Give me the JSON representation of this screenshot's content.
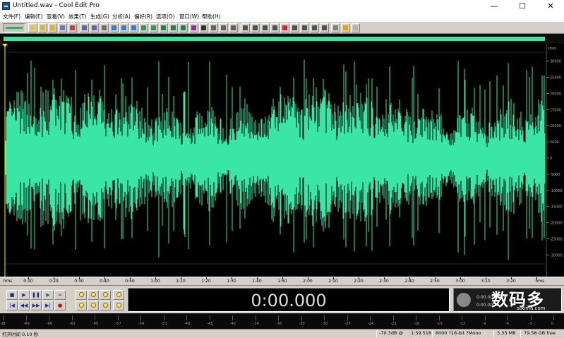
{
  "window": {
    "title": "Untitled.wav - Cool Edit Pro",
    "minimize": "—",
    "maximize": "☐",
    "close": "✕"
  },
  "menu": [
    "文件(F)",
    "编辑(E)",
    "查看(V)",
    "效果(T)",
    "生成(G)",
    "分析(A)",
    "偏好(R)",
    "选项(O)",
    "窗口(W)",
    "帮助(H)"
  ],
  "waveform": {
    "color": "#39e6a5",
    "axis_unit": "smpl",
    "amplitude_labels": [
      "30000",
      "25000",
      "20000",
      "15000",
      "10000",
      "5000",
      "0",
      "-5000",
      "-10000",
      "-15000",
      "-20000",
      "-25000",
      "-30000"
    ]
  },
  "time_ruler": {
    "labels": [
      "hms",
      "0:10",
      "0:20",
      "0:30",
      "0:40",
      "0:50",
      "1:00",
      "1:10",
      "1:20",
      "1:30",
      "1:40",
      "1:50",
      "2:00",
      "2:10",
      "2:20",
      "2:30",
      "2:40",
      "2:50",
      "3:00",
      "3:10",
      "3:20",
      "hms"
    ]
  },
  "transport": {
    "time": "0:00.000",
    "selection_begin": "0:00.000",
    "selection_end": "0:00.000",
    "buttons_row1": [
      "■",
      "▶",
      "❚❚",
      "▶",
      "∞"
    ],
    "buttons_row2": [
      "|◀",
      "◀◀",
      "▶▶",
      "▶|",
      "●"
    ]
  },
  "meter": {
    "labels": [
      "dB",
      "-69",
      "-66",
      "-63",
      "-60",
      "-57",
      "-54",
      "-51",
      "-48",
      "-45",
      "-42",
      "-39",
      "-36",
      "-33",
      "-30",
      "-27",
      "-24",
      "-21",
      "-18",
      "-15",
      "-12",
      "-9",
      "-6",
      "-3",
      "0"
    ]
  },
  "status": {
    "left": "打开时间  0.10 秒",
    "level": "-70.3dB @",
    "position": "1:59.518",
    "format": "8000 ?16-bit ?Mono",
    "size": "3.33 MB",
    "free": "79.58 GB free"
  },
  "watermark": {
    "text": "数码多",
    "sub": "sooma.com"
  }
}
